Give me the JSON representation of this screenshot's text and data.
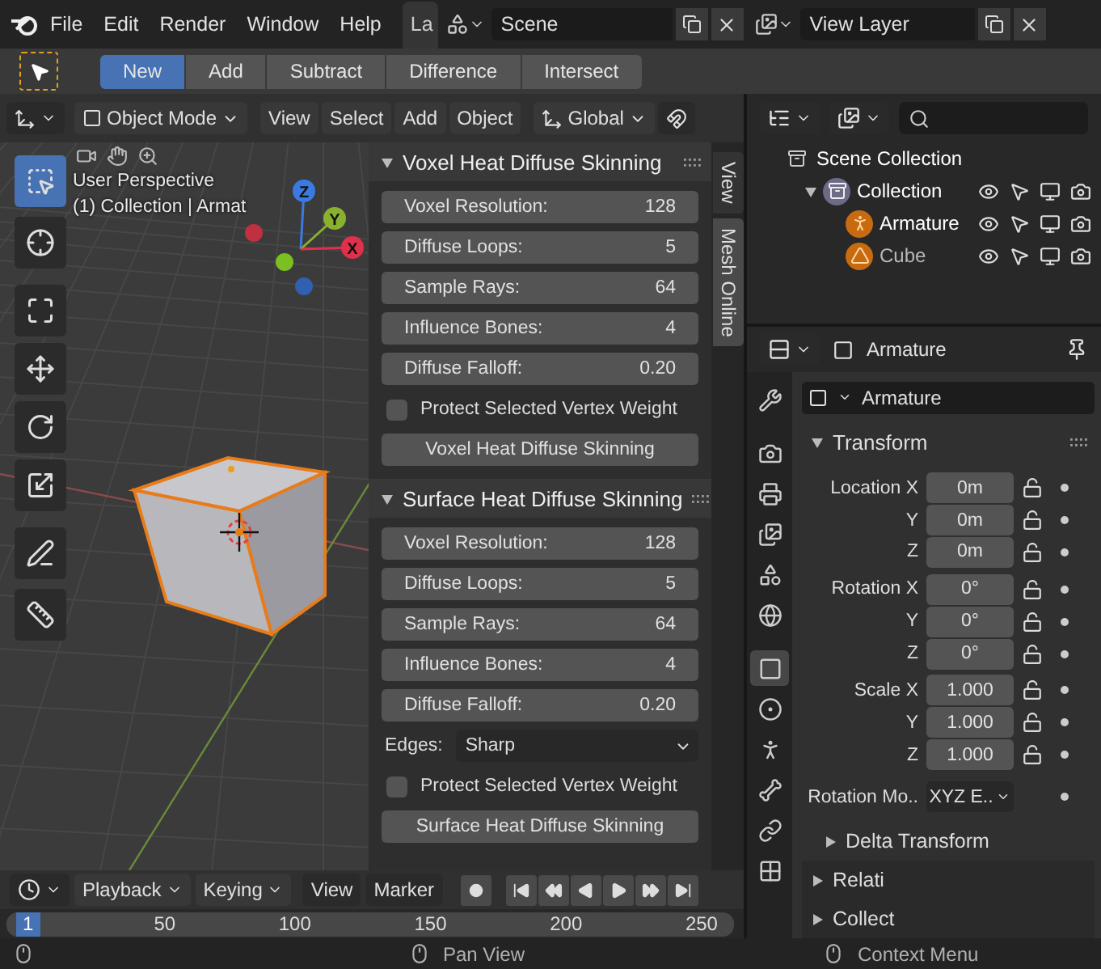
{
  "top_bar": {
    "menus": [
      "File",
      "Edit",
      "Render",
      "Window",
      "Help"
    ],
    "workspace_tab": "La",
    "scene": "Scene",
    "view_layer": "View Layer"
  },
  "tool_header": {
    "modes": [
      {
        "label": "New",
        "selected": true
      },
      {
        "label": "Add",
        "selected": false
      },
      {
        "label": "Subtract",
        "selected": false
      },
      {
        "label": "Difference",
        "selected": false
      },
      {
        "label": "Intersect",
        "selected": false
      }
    ]
  },
  "viewport_header": {
    "mode": "Object Mode",
    "menus": [
      "View",
      "Select",
      "Add",
      "Object"
    ],
    "orientation": "Global"
  },
  "viewport": {
    "overlay_lines": [
      "User Perspective",
      "(1) Collection | Armat"
    ],
    "axis_labels": [
      "Z",
      "Y",
      "X"
    ],
    "tools": [
      {
        "kind": "select",
        "selected": true
      },
      {
        "kind": "cursor",
        "selected": false
      },
      {
        "kind": "transform",
        "selected": false
      },
      {
        "kind": "move",
        "selected": false
      },
      {
        "kind": "rotate",
        "selected": false
      },
      {
        "kind": "scale",
        "selected": false
      },
      {
        "kind": "annotate",
        "selected": false
      },
      {
        "kind": "measure",
        "selected": false
      }
    ]
  },
  "sidebar": {
    "tabs": [
      {
        "label": "View",
        "selected": false
      },
      {
        "label": "Mesh Online",
        "selected": true
      }
    ],
    "panels": [
      {
        "title": "Voxel Heat Diffuse Skinning",
        "expanded": true,
        "fields": [
          {
            "label": "Voxel Resolution:",
            "value": "128"
          },
          {
            "label": "Diffuse Loops:",
            "value": "5"
          },
          {
            "label": "Sample Rays:",
            "value": "64"
          },
          {
            "label": "Influence Bones:",
            "value": "4"
          },
          {
            "label": "Diffuse Falloff:",
            "value": "0.20"
          }
        ],
        "checkbox": {
          "label": "Protect Selected Vertex Weight",
          "checked": false
        },
        "button": "Voxel Heat Diffuse Skinning"
      },
      {
        "title": "Surface Heat Diffuse Skinning",
        "expanded": true,
        "fields": [
          {
            "label": "Voxel Resolution:",
            "value": "128"
          },
          {
            "label": "Diffuse Loops:",
            "value": "5"
          },
          {
            "label": "Sample Rays:",
            "value": "64"
          },
          {
            "label": "Influence Bones:",
            "value": "4"
          },
          {
            "label": "Diffuse Falloff:",
            "value": "0.20"
          }
        ],
        "dropdown": {
          "label": "Edges:",
          "value": "Sharp"
        },
        "checkbox": {
          "label": "Protect Selected Vertex Weight",
          "checked": false
        },
        "button": "Surface Heat Diffuse Skinning"
      }
    ]
  },
  "outliner": {
    "items": [
      {
        "name": "Scene Collection",
        "kind": "scene",
        "children": [
          {
            "name": "Collection",
            "kind": "collection",
            "expanded": true,
            "children": [
              {
                "name": "Armature",
                "kind": "armature",
                "selected": true
              },
              {
                "name": "Cube",
                "kind": "mesh",
                "selected": false
              }
            ]
          }
        ]
      }
    ]
  },
  "properties": {
    "tabs": [
      {
        "kind": "tool",
        "selected": false
      },
      {
        "kind": "render",
        "selected": false
      },
      {
        "kind": "output",
        "selected": false
      },
      {
        "kind": "view_layer",
        "selected": false
      },
      {
        "kind": "scene",
        "selected": false
      },
      {
        "kind": "world",
        "selected": false
      },
      {
        "kind": "object",
        "selected": true
      },
      {
        "kind": "physics",
        "selected": false
      },
      {
        "kind": "data",
        "selected": false
      },
      {
        "kind": "bone",
        "selected": false
      },
      {
        "kind": "constraint",
        "selected": false
      },
      {
        "kind": "texture",
        "selected": false
      }
    ],
    "context": "Armature",
    "object_name": "Armature",
    "transform": {
      "title": "Transform",
      "expanded": true,
      "groups": [
        [
          {
            "label": "Location X",
            "value": "0m"
          },
          {
            "label": "Y",
            "value": "0m"
          },
          {
            "label": "Z",
            "value": "0m"
          }
        ],
        [
          {
            "label": "Rotation X",
            "value": "0°"
          },
          {
            "label": "Y",
            "value": "0°"
          },
          {
            "label": "Z",
            "value": "0°"
          }
        ],
        [
          {
            "label": "Scale X",
            "value": "1.000"
          },
          {
            "label": "Y",
            "value": "1.000"
          },
          {
            "label": "Z",
            "value": "1.000"
          }
        ]
      ],
      "rotation_mode": {
        "label": "Rotation Mo..",
        "value": "XYZ E.."
      }
    },
    "subpanels": [
      {
        "title": "Delta Transform",
        "expanded": false
      },
      {
        "title": "Relati",
        "expanded": false
      },
      {
        "title": "Collect",
        "expanded": false
      }
    ]
  },
  "timeline": {
    "menus": [
      {
        "label": "Playback",
        "kind": "dropdown"
      },
      {
        "label": "Keying",
        "kind": "dropdown"
      },
      {
        "label": "View",
        "kind": "plain"
      },
      {
        "label": "Marker",
        "kind": "plain"
      }
    ],
    "current_frame": "1",
    "ticks": [
      "50",
      "100",
      "150",
      "200",
      "250"
    ]
  },
  "status_bar": {
    "hints": [
      "Pan View",
      "Context Menu"
    ]
  }
}
